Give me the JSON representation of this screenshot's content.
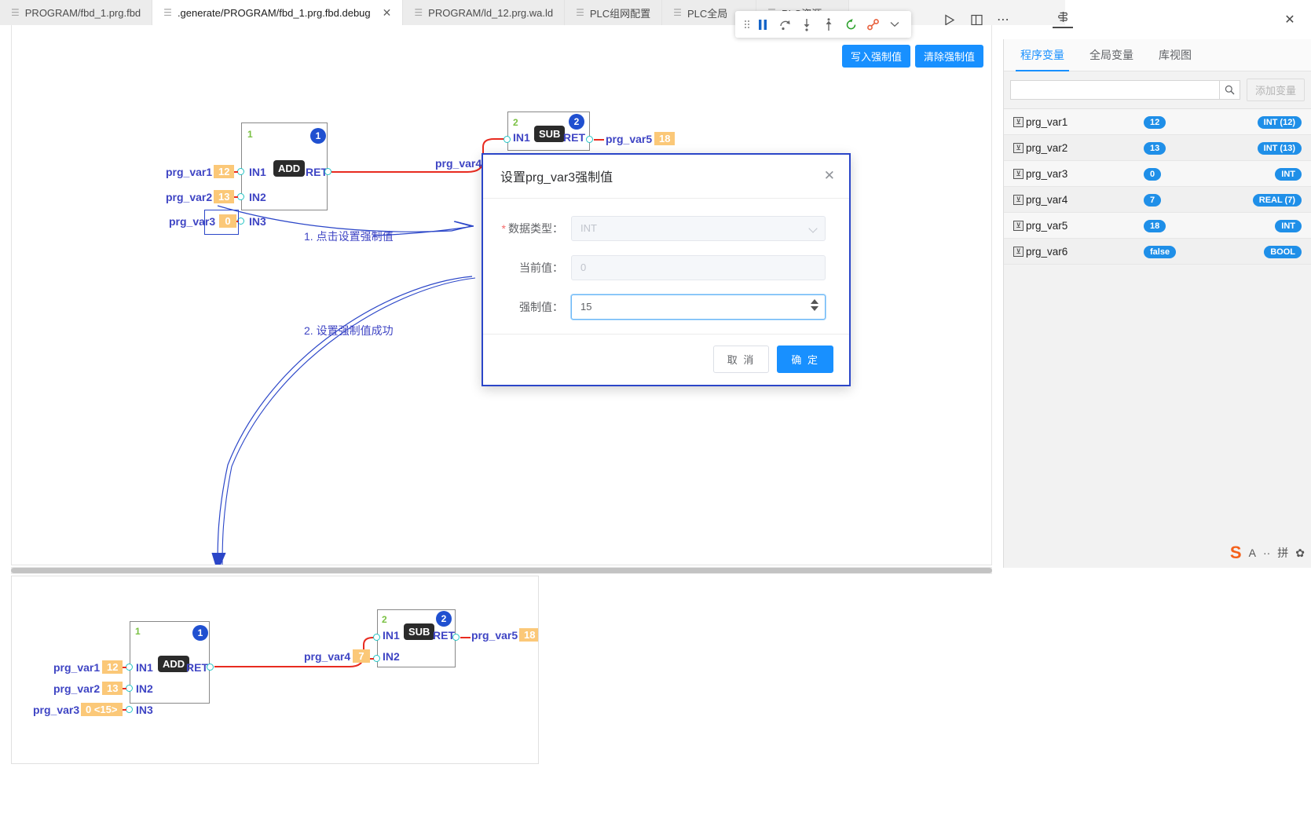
{
  "tabs": [
    {
      "label": "PROGRAM/fbd_1.prg.fbd",
      "active": false,
      "closable": false
    },
    {
      "label": ".generate/PROGRAM/fbd_1.prg.fbd.debug",
      "active": true,
      "closable": true
    },
    {
      "label": "PROGRAM/ld_12.prg.wa.ld",
      "active": false,
      "closable": false
    },
    {
      "label": "PLC组网配置",
      "active": false,
      "closable": false
    },
    {
      "label": "PLC全局",
      "active": false,
      "closable": false
    },
    {
      "label": "PLC资源",
      "active": false,
      "closable": false
    }
  ],
  "debug_toolbar": {
    "buttons": [
      {
        "name": "drag-handle-icon",
        "glyph": ""
      },
      {
        "name": "pause-icon",
        "glyph": "❚❚"
      },
      {
        "name": "step-over-icon",
        "glyph": "↷"
      },
      {
        "name": "step-into-icon",
        "glyph": "↓"
      },
      {
        "name": "step-out-icon",
        "glyph": "↑"
      },
      {
        "name": "restart-icon",
        "glyph": "↺"
      },
      {
        "name": "breakpoint-toggle-icon",
        "glyph": "⚯"
      },
      {
        "name": "chevron-down-icon",
        "glyph": "⌄"
      }
    ]
  },
  "panel_header": {
    "icons": [
      {
        "name": "run-icon",
        "glyph": "▷"
      },
      {
        "name": "split-layout-icon",
        "glyph": "▥"
      },
      {
        "name": "more-icon",
        "glyph": "⋯"
      },
      {
        "name": "variables-panel-icon",
        "glyph": "✿"
      },
      {
        "name": "close-icon",
        "glyph": "✕"
      }
    ]
  },
  "editor": {
    "toolbar": {
      "write_force_label": "写入强制值",
      "clear_force_label": "清除强制值"
    },
    "network1": {
      "index": "1",
      "badge": "1",
      "operator": "ADD",
      "ret_label": "RET",
      "inputs": [
        {
          "pin": "IN1",
          "var": "prg_var1",
          "value": "12",
          "selected": false
        },
        {
          "pin": "IN2",
          "var": "prg_var2",
          "value": "13",
          "selected": false
        },
        {
          "pin": "IN3",
          "var": "prg_var3",
          "value": "0",
          "selected": true
        }
      ]
    },
    "network2": {
      "index": "2",
      "badge": "2",
      "operator": "SUB",
      "ret_label": "RET",
      "in1_label": "IN1",
      "output_var": "prg_var5",
      "output_value": "18",
      "wire_var": "prg_var4"
    },
    "annotations": [
      {
        "text": "1. 点击设置强制值"
      },
      {
        "text": "2. 设置强制值成功"
      }
    ]
  },
  "dialog": {
    "title": "设置prg_var3强制值",
    "close_icon": "✕",
    "fields": [
      {
        "label": "数据类型：",
        "required": true,
        "value": "INT",
        "placeholder": "INT",
        "disabled": true,
        "control": "select"
      },
      {
        "label": "当前值：",
        "required": false,
        "value": "",
        "placeholder": "0",
        "disabled": true,
        "control": "input"
      },
      {
        "label": "强制值：",
        "required": false,
        "value": "15",
        "placeholder": "",
        "disabled": false,
        "control": "number"
      }
    ],
    "cancel_label": "取 消",
    "confirm_label": "确 定"
  },
  "right_panel": {
    "tabs": [
      {
        "label": "程序变量",
        "active": true
      },
      {
        "label": "全局变量",
        "active": false
      },
      {
        "label": "库视图",
        "active": false
      }
    ],
    "search_placeholder": "",
    "search_value": "",
    "search_icon": "search-icon",
    "add_variable_label": "添加变量",
    "variables": [
      {
        "name": "prg_var1",
        "value": "12",
        "type": "INT (12)"
      },
      {
        "name": "prg_var2",
        "value": "13",
        "type": "INT (13)"
      },
      {
        "name": "prg_var3",
        "value": "0",
        "type": "INT"
      },
      {
        "name": "prg_var4",
        "value": "7",
        "type": "REAL (7)"
      },
      {
        "name": "prg_var5",
        "value": "18",
        "type": "INT"
      },
      {
        "name": "prg_var6",
        "value": "false",
        "type": "BOOL"
      }
    ]
  },
  "ime": {
    "logo": "S",
    "mode_letter": "A",
    "dots": "··",
    "pinyin": "拼",
    "gear": "✿"
  },
  "bottom_panel": {
    "network1": {
      "index": "1",
      "badge": "1",
      "operator": "ADD",
      "ret_label": "RET",
      "inputs": [
        {
          "pin": "IN1",
          "var": "prg_var1",
          "value": "12"
        },
        {
          "pin": "IN2",
          "var": "prg_var2",
          "value": "13"
        },
        {
          "pin": "IN3",
          "var": "prg_var3",
          "value": "0 <15>"
        }
      ]
    },
    "network2": {
      "index": "2",
      "badge": "2",
      "operator": "SUB",
      "ret_label": "RET",
      "inputs": [
        {
          "pin": "IN1",
          "var": "",
          "value": ""
        },
        {
          "pin": "IN2",
          "var": "prg_var4",
          "value": "7"
        }
      ],
      "output_var": "prg_var5",
      "output_value": "18"
    }
  },
  "colors": {
    "accent": "#1890ff",
    "wire": "#e82b20",
    "value_badge": "#fbc878",
    "label": "#3f45c4",
    "pin": "#23c4c4",
    "network_index": "#7ac143",
    "badge": "#2050d0",
    "annotation": "#3f45c4"
  }
}
